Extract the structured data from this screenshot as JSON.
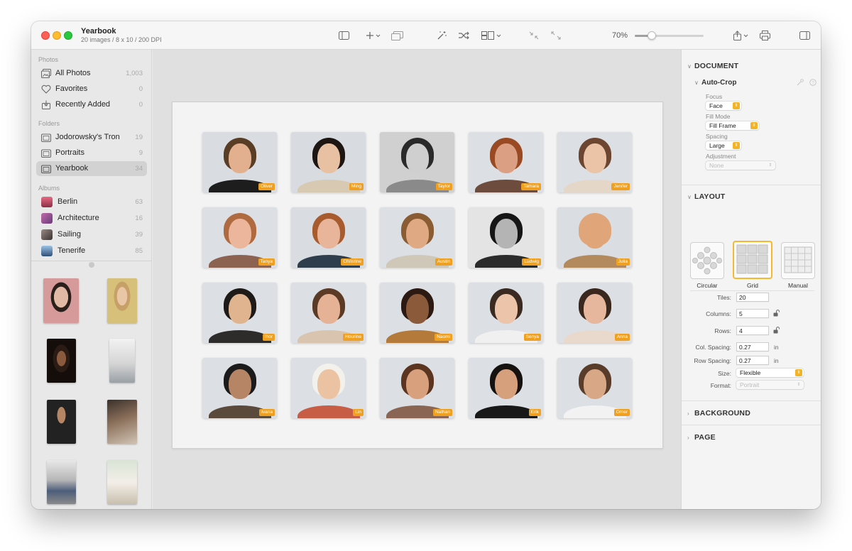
{
  "window": {
    "title": "Yearbook",
    "subtitle": "20 images / 8 x 10 / 200 DPI"
  },
  "toolbar": {
    "icons": [
      "sidebar-toggle-icon",
      "add-icon",
      "chevron-down-icon",
      "slideshow-icon",
      "magic-wand-icon",
      "shuffle-icon",
      "layout-icon",
      "chevron-down-icon",
      "shrink-icon",
      "expand-icon",
      "share-icon",
      "print-icon",
      "inspector-toggle-icon"
    ],
    "zoom_label": "70%",
    "zoom_value": 0.25
  },
  "sidebar": {
    "photos_header": "Photos",
    "photos": [
      {
        "label": "All Photos",
        "count": "1,003",
        "icon": "photo-library-icon"
      },
      {
        "label": "Favorites",
        "count": "0",
        "icon": "heart-icon"
      },
      {
        "label": "Recently Added",
        "count": "0",
        "icon": "import-icon"
      }
    ],
    "folders_header": "Folders",
    "folders": [
      {
        "label": "Jodorowsky's Tron",
        "count": "19",
        "icon": "folder-photos-icon"
      },
      {
        "label": "Portraits",
        "count": "9",
        "icon": "folder-photos-icon"
      },
      {
        "label": "Yearbook",
        "count": "34",
        "icon": "folder-photos-icon",
        "selected": true
      }
    ],
    "albums_header": "Albums",
    "albums": [
      {
        "label": "Berlin",
        "count": "63",
        "color": "#c8506a"
      },
      {
        "label": "Architecture",
        "count": "16",
        "color": "#9a4f86"
      },
      {
        "label": "Sailing",
        "count": "39",
        "color": "#6c6060"
      },
      {
        "label": "Tenerife",
        "count": "85",
        "color": "#4b6f9e"
      }
    ]
  },
  "canvas": {
    "tiles": [
      {
        "name": "Oliver",
        "skin": "#e2b08e",
        "hair": "#5a3d25",
        "shirt": "#1d1d1d",
        "bg": "#d9dde2"
      },
      {
        "name": "Ming",
        "skin": "#e8c0a2",
        "hair": "#1d1612",
        "shirt": "#d8c9b3",
        "bg": "#d8dce1"
      },
      {
        "name": "Taylor",
        "skin": "#cfcfcf",
        "hair": "#2a2a2a",
        "shirt": "#8a8a8a",
        "bg": "#d0d0d0"
      },
      {
        "name": "Tamara",
        "skin": "#dba083",
        "hair": "#9a4a22",
        "shirt": "#6d4c3d",
        "bg": "#dcdfe3"
      },
      {
        "name": "Jenifer",
        "skin": "#ebc3a6",
        "hair": "#6c4630",
        "shirt": "#e5d7c8",
        "bg": "#dcdfe3"
      },
      {
        "name": "Tanya",
        "skin": "#ebb69b",
        "hair": "#b06a40",
        "shirt": "#8c6250",
        "bg": "#dcdfe3"
      },
      {
        "name": "Christine",
        "skin": "#e8b59a",
        "hair": "#a85b2d",
        "shirt": "#2f3e4d",
        "bg": "#d9dde2"
      },
      {
        "name": "Austin",
        "skin": "#dfa983",
        "hair": "#8a5c34",
        "shirt": "#cfc7b8",
        "bg": "#dcdfe3"
      },
      {
        "name": "Ludwig",
        "skin": "#b4b4b4",
        "hair": "#151515",
        "shirt": "#2b2b2b",
        "bg": "#e4e4e4"
      },
      {
        "name": "Julia",
        "skin": "#e0a578",
        "hair": "#e0a578",
        "shirt": "#b38a5e",
        "bg": "#dadde2"
      },
      {
        "name": "Ihor",
        "skin": "#e0b48e",
        "hair": "#1e1a17",
        "shirt": "#2e2b2b",
        "bg": "#dcdfe3"
      },
      {
        "name": "Hourine",
        "skin": "#e5b295",
        "hair": "#5b3a26",
        "shirt": "#d9c4b0",
        "bg": "#dcdfe3"
      },
      {
        "name": "Naomi",
        "skin": "#8b5a3a",
        "hair": "#2c1a12",
        "shirt": "#b37a3a",
        "bg": "#dcdfe3"
      },
      {
        "name": "Senya",
        "skin": "#ecc4a9",
        "hair": "#3a2a22",
        "shirt": "#f0f0f0",
        "bg": "#dcdfe3"
      },
      {
        "name": "Anna",
        "skin": "#e6b79c",
        "hair": "#3a281f",
        "shirt": "#e9d9cc",
        "bg": "#dcdfe3"
      },
      {
        "name": "Ivana",
        "skin": "#b58565",
        "hair": "#1b1b1b",
        "shirt": "#5a4a3c",
        "bg": "#dcdfe3"
      },
      {
        "name": "Lin",
        "skin": "#ecc3a2",
        "hair": "#f3f1ec",
        "shirt": "#c75d44",
        "bg": "#dcdfe3"
      },
      {
        "name": "Nathan",
        "skin": "#d8a07d",
        "hair": "#5b3520",
        "shirt": "#8a6553",
        "bg": "#dcdfe3"
      },
      {
        "name": "Erik",
        "skin": "#d7a07c",
        "hair": "#151210",
        "shirt": "#181818",
        "bg": "#dcdfe3"
      },
      {
        "name": "Omer",
        "skin": "#d8a786",
        "hair": "#5a3c2a",
        "shirt": "#f2f2f2",
        "bg": "#dcdfe3"
      }
    ]
  },
  "inspector": {
    "document_header": "DOCUMENT",
    "auto_crop_header": "Auto-Crop",
    "focus_label": "Focus",
    "focus_value": "Face",
    "fill_mode_label": "Fill Mode",
    "fill_mode_value": "Fill Frame",
    "spacing_label": "Spacing",
    "spacing_value": "Large",
    "adjustment_label": "Adjustment",
    "adjustment_value": "None",
    "layout_header": "LAYOUT",
    "layout_options": [
      "Circular",
      "Grid",
      "Manual"
    ],
    "layout_selected": "Grid",
    "tiles_label": "Tiles:",
    "tiles_value": "20",
    "columns_label": "Columns:",
    "columns_value": "5",
    "rows_label": "Rows:",
    "rows_value": "4",
    "col_spacing_label": "Col. Spacing:",
    "col_spacing_value": "0.27",
    "row_spacing_label": "Row Spacing:",
    "row_spacing_value": "0.27",
    "unit": "in",
    "size_label": "Size:",
    "size_value": "Flexible",
    "format_label": "Format:",
    "format_value": "Portrait",
    "background_header": "BACKGROUND",
    "page_header": "PAGE",
    "accent_color": "#f5b82e"
  }
}
